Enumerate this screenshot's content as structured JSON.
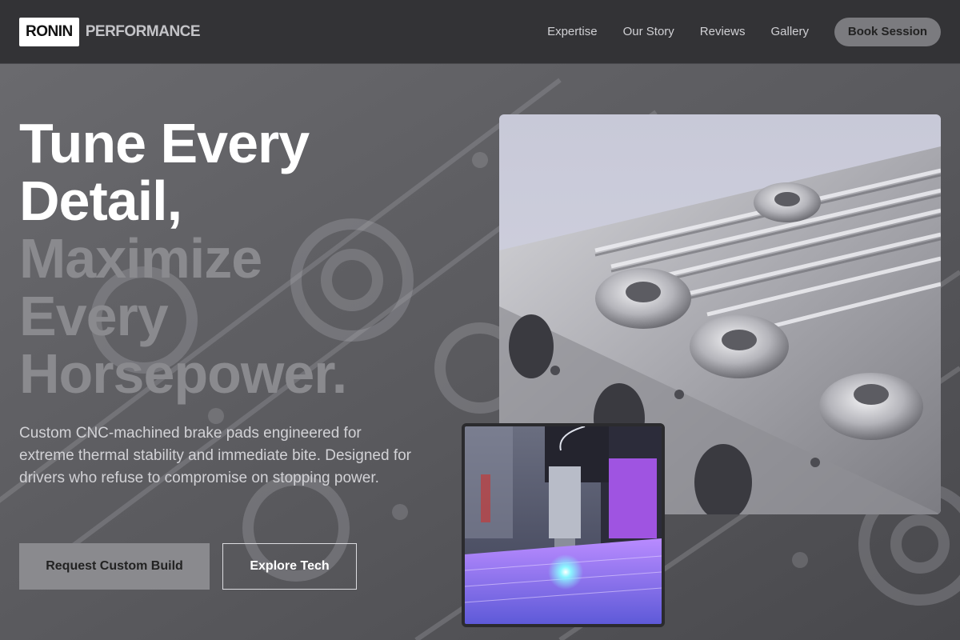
{
  "header": {
    "logo_box": "RONIN",
    "logo_text": "PERFORMANCE",
    "nav": [
      "Expertise",
      "Our Story",
      "Reviews",
      "Gallery"
    ],
    "cta": "Book Session"
  },
  "hero": {
    "title_lines": [
      "Tune Every",
      "Detail,",
      "Maximize",
      "Every",
      "Horsepower."
    ],
    "description": "Custom CNC-machined brake pads engineered for extreme thermal stability and immediate bite. Designed for drivers who refuse to compromise on stopping power.",
    "primary_cta": "Request Custom Build",
    "secondary_cta": "Explore Tech"
  },
  "images": {
    "background": "machined-aluminum-part-background",
    "main_photo": "machined-aluminum-block-photo",
    "inset_photo": "cnc-laser-engraving-photo"
  },
  "colors": {
    "header_bg": "#333336",
    "page_bg": "#5e5e62",
    "title_bright": "#ffffff",
    "title_dim": "#8a8a8e",
    "button_grey": "#8a8a8e",
    "laser_glow": "#c062ff"
  }
}
